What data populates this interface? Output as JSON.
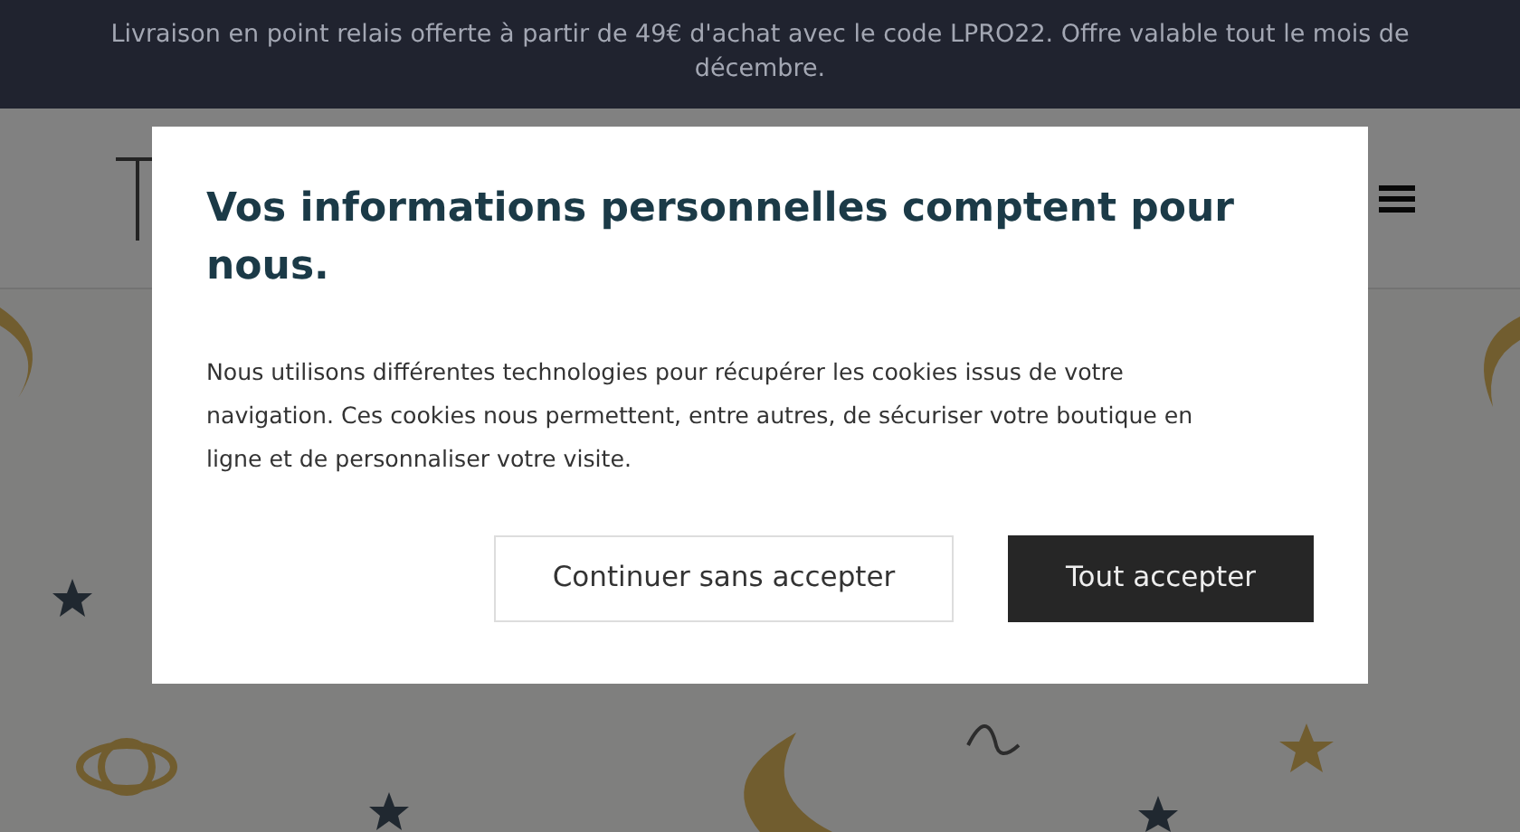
{
  "announcement_bar": {
    "text": "Livraison en point relais offerte à partir de 49€ d'achat avec le code LPRO22. Offre valable tout le mois de décembre."
  },
  "cookie_modal": {
    "title": "Vos informations personnelles comptent pour nous.",
    "body": "Nous utilisons différentes technologies pour récupérer les cookies issus de votre navigation. Ces cookies nous permettent, entre autres, de sécuriser votre boutique en ligne et de personnaliser votre visite.",
    "buttons": [
      {
        "label": "Continuer sans accepter",
        "kind": "outline"
      },
      {
        "label": "Tout accepter",
        "kind": "primary"
      }
    ]
  }
}
